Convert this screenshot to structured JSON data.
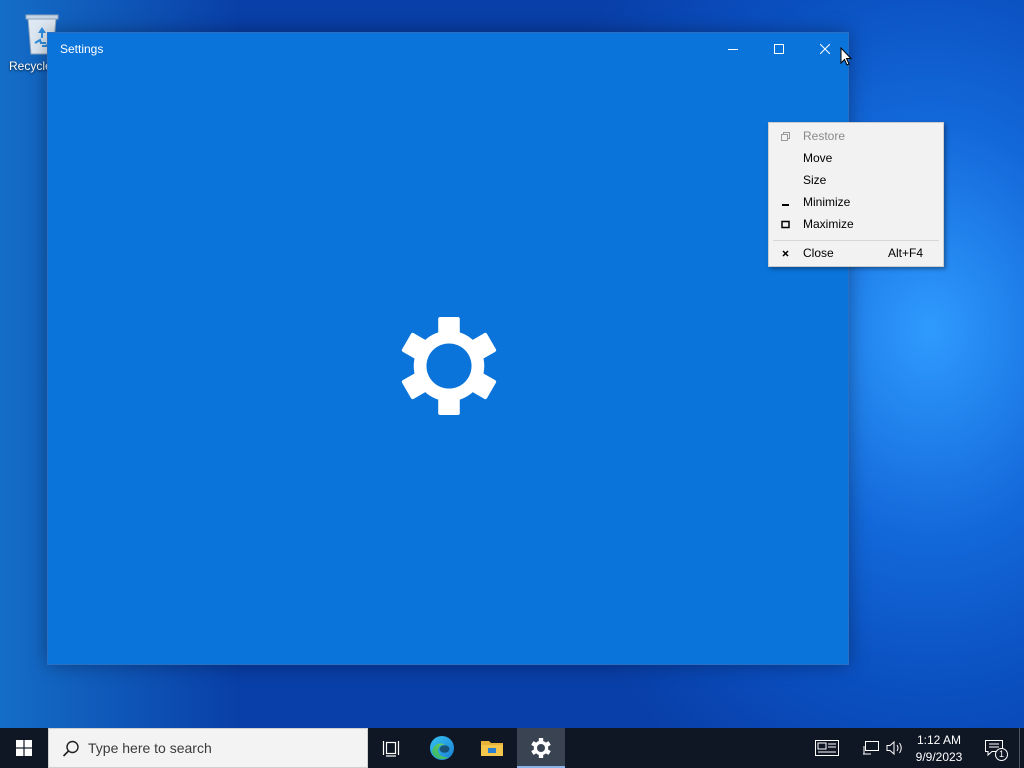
{
  "desktop": {
    "icons": [
      {
        "label": "Recycle Bin",
        "visible_label": "Recycle",
        "icon": "recycle-bin-icon"
      }
    ]
  },
  "window": {
    "title": "Settings",
    "accent_color": "#0a74da",
    "splash_icon": "gear-icon",
    "caption_buttons": [
      {
        "name": "minimize",
        "icon": "minimize-icon"
      },
      {
        "name": "maximize",
        "icon": "maximize-icon"
      },
      {
        "name": "close",
        "icon": "close-icon"
      }
    ]
  },
  "system_menu": {
    "items": [
      {
        "label": "Restore",
        "icon": "restore-icon",
        "enabled": false,
        "shortcut": ""
      },
      {
        "label": "Move",
        "icon": "",
        "enabled": true,
        "shortcut": ""
      },
      {
        "label": "Size",
        "icon": "",
        "enabled": true,
        "shortcut": ""
      },
      {
        "label": "Minimize",
        "icon": "minimize-icon",
        "enabled": true,
        "shortcut": ""
      },
      {
        "label": "Maximize",
        "icon": "maximize-icon",
        "enabled": true,
        "shortcut": ""
      },
      {
        "label": "Close",
        "icon": "close-icon",
        "enabled": true,
        "shortcut": "Alt+F4"
      }
    ]
  },
  "taskbar": {
    "search_placeholder": "Type here to search",
    "pinned": [
      {
        "name": "Task View",
        "icon": "task-view-icon"
      },
      {
        "name": "Microsoft Edge",
        "icon": "edge-icon"
      },
      {
        "name": "File Explorer",
        "icon": "folder-icon"
      },
      {
        "name": "Settings",
        "icon": "gear-icon",
        "active": true
      }
    ],
    "tray": {
      "time": "1:12 AM",
      "date": "9/9/2023",
      "notification_count": "1"
    }
  }
}
